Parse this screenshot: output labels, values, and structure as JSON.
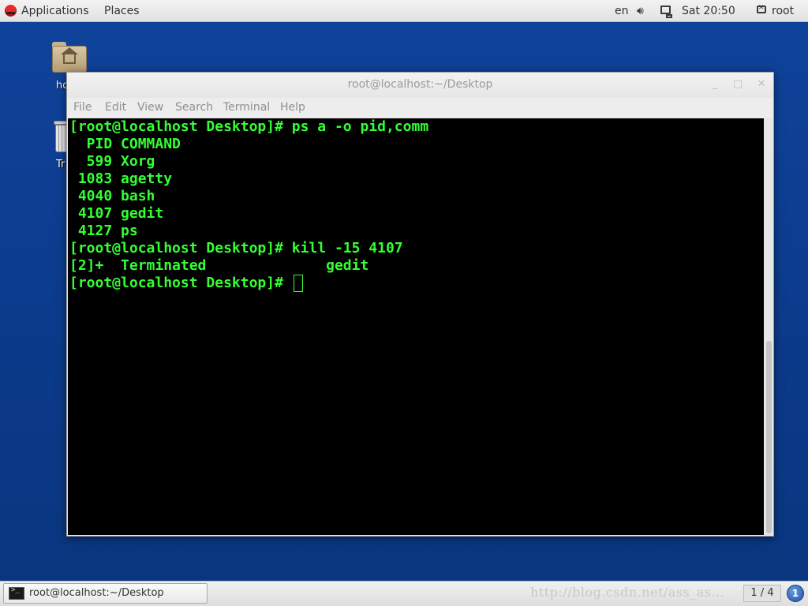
{
  "top_panel": {
    "applications_label": "Applications",
    "places_label": "Places",
    "keyboard_layout": "en",
    "volume_icon": "volume-icon",
    "network_icon": "network-icon",
    "clock": "Sat 20:50",
    "user_label": "root"
  },
  "desktop": {
    "home_label": "ho",
    "trash_label": "Tr"
  },
  "window": {
    "title": "root@localhost:~/Desktop",
    "controls": {
      "minimize": "_",
      "maximize": "□",
      "close": "✕"
    },
    "menu": [
      "File",
      "Edit",
      "View",
      "Search",
      "Terminal",
      "Help"
    ]
  },
  "terminal": {
    "lines": [
      "[root@localhost Desktop]# ps a -o pid,comm",
      "  PID COMMAND",
      "  599 Xorg",
      " 1083 agetty",
      " 4040 bash",
      " 4107 gedit",
      " 4127 ps",
      "[root@localhost Desktop]# kill -15 4107",
      "[2]+  Terminated              gedit",
      "[root@localhost Desktop]# "
    ],
    "text_color": "#33ff33",
    "background_color": "#000000"
  },
  "taskbar": {
    "task_label": "root@localhost:~/Desktop",
    "watermark": "http://blog.csdn.net/ass_as…",
    "workspace": "1 / 4",
    "notification_count": "1"
  }
}
